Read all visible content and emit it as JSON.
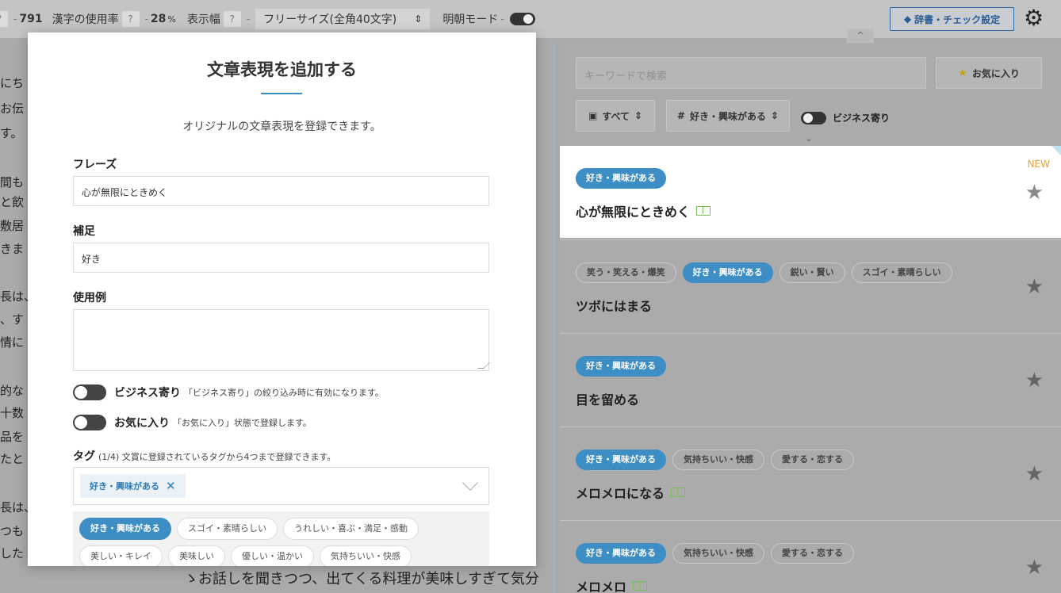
{
  "topbar": {
    "help": "?",
    "dash": "-",
    "char_count": "791",
    "kanji_label": "漢字の使用率",
    "kanji_value": "28",
    "kanji_unit": "%",
    "width_label": "表示幅",
    "width_option": "フリーサイズ(全角40文字)",
    "width_chevron": "⇕",
    "mincho_label": "明朝モード",
    "dict_button": "辞書・チェック設定",
    "collapse": "^"
  },
  "editor": {
    "edge_lines": [
      "にち",
      "お伝",
      "す。",
      "間も",
      "と飲",
      "敷居",
      "きま",
      "長は、",
      "、す",
      "情に",
      "的な",
      "十数",
      "品を",
      "たと",
      "長は、",
      "つも",
      "した"
    ],
    "bottom_line": "ゝお話しを聞きつつ、出てくる料理が美味しすぎて気分"
  },
  "panel": {
    "search_placeholder": "キーワードで検索",
    "favorites_button": "お気に入り",
    "filter_all": "すべて",
    "filter_tag": "好き・興味がある",
    "business_toggle": "ビジネス寄り",
    "cards": [
      {
        "tags": [
          {
            "label": "好き・興味がある",
            "on": true
          }
        ],
        "phrase": "心が無限にときめく",
        "book": true,
        "new": "NEW",
        "active": true
      },
      {
        "tags": [
          {
            "label": "笑う・笑える・爆笑",
            "on": false
          },
          {
            "label": "好き・興味がある",
            "on": true
          },
          {
            "label": "鋭い・賢い",
            "on": false
          },
          {
            "label": "スゴイ・素晴らしい",
            "on": false
          }
        ],
        "phrase": "ツボにはまる",
        "book": false
      },
      {
        "tags": [
          {
            "label": "好き・興味がある",
            "on": true
          }
        ],
        "phrase": "目を留める",
        "book": false
      },
      {
        "tags": [
          {
            "label": "好き・興味がある",
            "on": true
          },
          {
            "label": "気持ちいい・快感",
            "on": false
          },
          {
            "label": "愛する・恋する",
            "on": false
          }
        ],
        "phrase": "メロメロになる",
        "book": true
      },
      {
        "tags": [
          {
            "label": "好き・興味がある",
            "on": true
          },
          {
            "label": "気持ちいい・快感",
            "on": false
          },
          {
            "label": "愛する・恋する",
            "on": false
          }
        ],
        "phrase": "メロメロ",
        "book": true
      }
    ]
  },
  "modal": {
    "title": "文章表現を追加する",
    "description": "オリジナルの文章表現を登録できます。",
    "phrase_label": "フレーズ",
    "phrase_value": "心が無限にときめく",
    "note_label": "補足",
    "note_value": "好き",
    "example_label": "使用例",
    "example_value": "",
    "business_label": "ビジネス寄り",
    "business_note": "「ビジネス寄り」の絞り込み時に有効になります。",
    "fav_label": "お気に入り",
    "fav_note": "「お気に入り」状態で登録します。",
    "tag_label": "タグ",
    "tag_count_note": "(1/4) 文賞に登録されているタグから4つまで登録できます。",
    "selected_tag": "好き・興味がある",
    "pool_tags": [
      {
        "label": "好き・興味がある",
        "on": true
      },
      {
        "label": "スゴイ・素晴らしい",
        "on": false
      },
      {
        "label": "うれしい・喜ぶ・満足・感動",
        "on": false
      },
      {
        "label": "美しい・キレイ",
        "on": false
      },
      {
        "label": "美味しい",
        "on": false
      },
      {
        "label": "優しい・温かい",
        "on": false
      },
      {
        "label": "気持ちいい・快感",
        "on": false
      }
    ]
  },
  "colors": {
    "accent": "#3e8ec6",
    "new_badge": "#e6a23c",
    "book_icon": "#7bbd5b"
  }
}
